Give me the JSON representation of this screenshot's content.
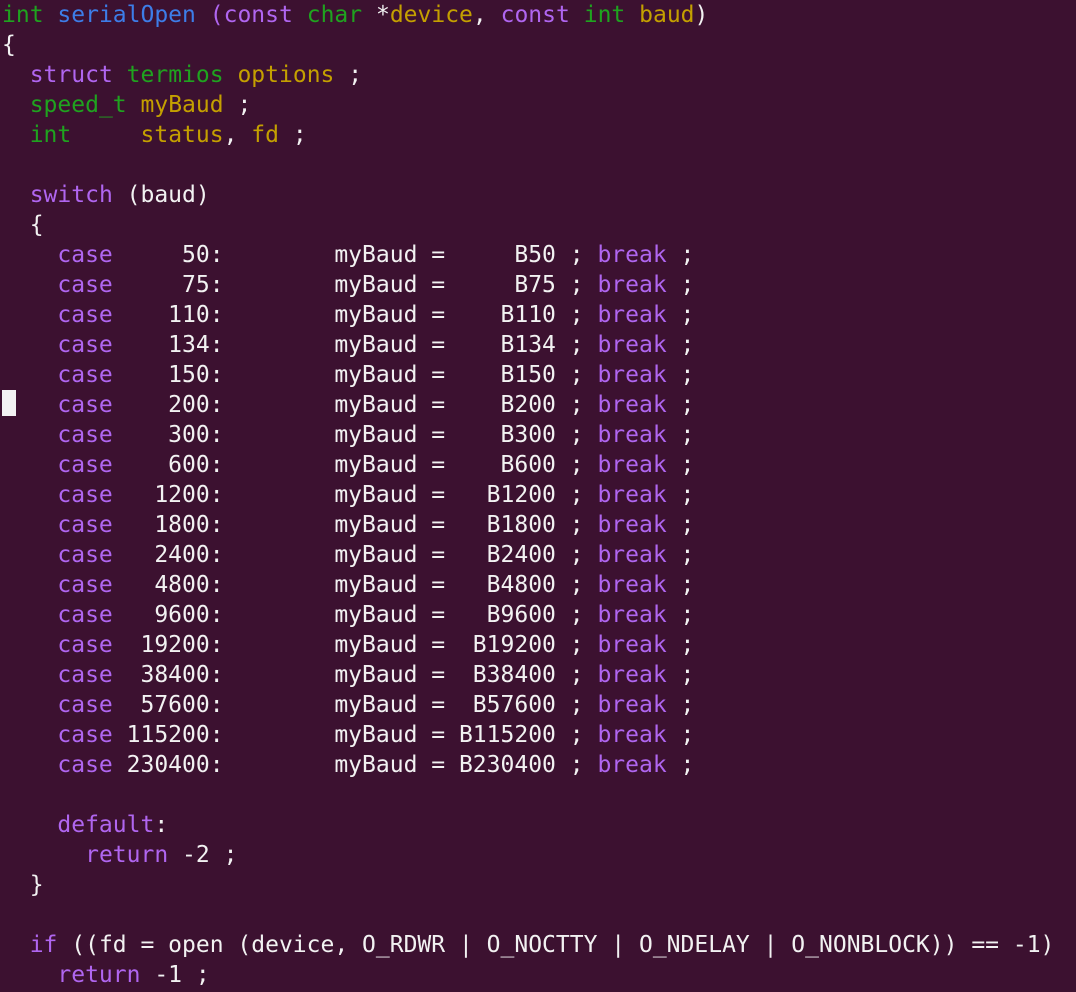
{
  "colors": {
    "background": "#3c1130",
    "plain": "#f2f2f2",
    "keyword": "#b066f0",
    "type": "#1fa31f",
    "identifier": "#c4a000",
    "function": "#3d7de8"
  },
  "lines": [
    [
      {
        "t": "int",
        "c": "type"
      },
      {
        "t": " ",
        "c": "plain"
      },
      {
        "t": "serialOpen",
        "c": "function"
      },
      {
        "t": " ",
        "c": "plain"
      },
      {
        "t": "(",
        "c": "keyword"
      },
      {
        "t": "const",
        "c": "keyword"
      },
      {
        "t": " ",
        "c": "plain"
      },
      {
        "t": "char",
        "c": "type"
      },
      {
        "t": " *",
        "c": "plain"
      },
      {
        "t": "device",
        "c": "identifier"
      },
      {
        "t": ", ",
        "c": "plain"
      },
      {
        "t": "const",
        "c": "keyword"
      },
      {
        "t": " ",
        "c": "plain"
      },
      {
        "t": "int",
        "c": "type"
      },
      {
        "t": " ",
        "c": "plain"
      },
      {
        "t": "baud",
        "c": "identifier"
      },
      {
        "t": ")",
        "c": "plain"
      }
    ],
    [
      {
        "t": "{",
        "c": "plain"
      }
    ],
    [
      {
        "t": "  ",
        "c": "plain"
      },
      {
        "t": "struct",
        "c": "keyword"
      },
      {
        "t": " ",
        "c": "plain"
      },
      {
        "t": "termios",
        "c": "type"
      },
      {
        "t": " ",
        "c": "plain"
      },
      {
        "t": "options",
        "c": "identifier"
      },
      {
        "t": " ;",
        "c": "plain"
      }
    ],
    [
      {
        "t": "  ",
        "c": "plain"
      },
      {
        "t": "speed_t",
        "c": "type"
      },
      {
        "t": " ",
        "c": "plain"
      },
      {
        "t": "myBaud",
        "c": "identifier"
      },
      {
        "t": " ;",
        "c": "plain"
      }
    ],
    [
      {
        "t": "  ",
        "c": "plain"
      },
      {
        "t": "int",
        "c": "type"
      },
      {
        "t": "     ",
        "c": "plain"
      },
      {
        "t": "status",
        "c": "identifier"
      },
      {
        "t": ", ",
        "c": "plain"
      },
      {
        "t": "fd",
        "c": "identifier"
      },
      {
        "t": " ;",
        "c": "plain"
      }
    ],
    [],
    [
      {
        "t": "  ",
        "c": "plain"
      },
      {
        "t": "switch",
        "c": "keyword"
      },
      {
        "t": " (baud)",
        "c": "plain"
      }
    ],
    [
      {
        "t": "  {",
        "c": "plain"
      }
    ],
    [
      {
        "t": "    ",
        "c": "plain"
      },
      {
        "t": "case",
        "c": "keyword"
      },
      {
        "t": "     50:        myBaud =     B50 ; ",
        "c": "plain"
      },
      {
        "t": "break",
        "c": "keyword"
      },
      {
        "t": " ;",
        "c": "plain"
      }
    ],
    [
      {
        "t": "    ",
        "c": "plain"
      },
      {
        "t": "case",
        "c": "keyword"
      },
      {
        "t": "     75:        myBaud =     B75 ; ",
        "c": "plain"
      },
      {
        "t": "break",
        "c": "keyword"
      },
      {
        "t": " ;",
        "c": "plain"
      }
    ],
    [
      {
        "t": "    ",
        "c": "plain"
      },
      {
        "t": "case",
        "c": "keyword"
      },
      {
        "t": "    110:        myBaud =    B110 ; ",
        "c": "plain"
      },
      {
        "t": "break",
        "c": "keyword"
      },
      {
        "t": " ;",
        "c": "plain"
      }
    ],
    [
      {
        "t": "    ",
        "c": "plain"
      },
      {
        "t": "case",
        "c": "keyword"
      },
      {
        "t": "    134:        myBaud =    B134 ; ",
        "c": "plain"
      },
      {
        "t": "break",
        "c": "keyword"
      },
      {
        "t": " ;",
        "c": "plain"
      }
    ],
    [
      {
        "t": "    ",
        "c": "plain"
      },
      {
        "t": "case",
        "c": "keyword"
      },
      {
        "t": "    150:        myBaud =    B150 ; ",
        "c": "plain"
      },
      {
        "t": "break",
        "c": "keyword"
      },
      {
        "t": " ;",
        "c": "plain"
      }
    ],
    [
      {
        "t": "    ",
        "c": "plain"
      },
      {
        "t": "case",
        "c": "keyword"
      },
      {
        "t": "    200:        myBaud =    B200 ; ",
        "c": "plain"
      },
      {
        "t": "break",
        "c": "keyword"
      },
      {
        "t": " ;",
        "c": "plain"
      }
    ],
    [
      {
        "t": "    ",
        "c": "plain"
      },
      {
        "t": "case",
        "c": "keyword"
      },
      {
        "t": "    300:        myBaud =    B300 ; ",
        "c": "plain"
      },
      {
        "t": "break",
        "c": "keyword"
      },
      {
        "t": " ;",
        "c": "plain"
      }
    ],
    [
      {
        "t": "    ",
        "c": "plain"
      },
      {
        "t": "case",
        "c": "keyword"
      },
      {
        "t": "    600:        myBaud =    B600 ; ",
        "c": "plain"
      },
      {
        "t": "break",
        "c": "keyword"
      },
      {
        "t": " ;",
        "c": "plain"
      }
    ],
    [
      {
        "t": "    ",
        "c": "plain"
      },
      {
        "t": "case",
        "c": "keyword"
      },
      {
        "t": "   1200:        myBaud =   B1200 ; ",
        "c": "plain"
      },
      {
        "t": "break",
        "c": "keyword"
      },
      {
        "t": " ;",
        "c": "plain"
      }
    ],
    [
      {
        "t": "    ",
        "c": "plain"
      },
      {
        "t": "case",
        "c": "keyword"
      },
      {
        "t": "   1800:        myBaud =   B1800 ; ",
        "c": "plain"
      },
      {
        "t": "break",
        "c": "keyword"
      },
      {
        "t": " ;",
        "c": "plain"
      }
    ],
    [
      {
        "t": "    ",
        "c": "plain"
      },
      {
        "t": "case",
        "c": "keyword"
      },
      {
        "t": "   2400:        myBaud =   B2400 ; ",
        "c": "plain"
      },
      {
        "t": "break",
        "c": "keyword"
      },
      {
        "t": " ;",
        "c": "plain"
      }
    ],
    [
      {
        "t": "    ",
        "c": "plain"
      },
      {
        "t": "case",
        "c": "keyword"
      },
      {
        "t": "   4800:        myBaud =   B4800 ; ",
        "c": "plain"
      },
      {
        "t": "break",
        "c": "keyword"
      },
      {
        "t": " ;",
        "c": "plain"
      }
    ],
    [
      {
        "t": "    ",
        "c": "plain"
      },
      {
        "t": "case",
        "c": "keyword"
      },
      {
        "t": "   9600:        myBaud =   B9600 ; ",
        "c": "plain"
      },
      {
        "t": "break",
        "c": "keyword"
      },
      {
        "t": " ;",
        "c": "plain"
      }
    ],
    [
      {
        "t": "    ",
        "c": "plain"
      },
      {
        "t": "case",
        "c": "keyword"
      },
      {
        "t": "  19200:        myBaud =  B19200 ; ",
        "c": "plain"
      },
      {
        "t": "break",
        "c": "keyword"
      },
      {
        "t": " ;",
        "c": "plain"
      }
    ],
    [
      {
        "t": "    ",
        "c": "plain"
      },
      {
        "t": "case",
        "c": "keyword"
      },
      {
        "t": "  38400:        myBaud =  B38400 ; ",
        "c": "plain"
      },
      {
        "t": "break",
        "c": "keyword"
      },
      {
        "t": " ;",
        "c": "plain"
      }
    ],
    [
      {
        "t": "    ",
        "c": "plain"
      },
      {
        "t": "case",
        "c": "keyword"
      },
      {
        "t": "  57600:        myBaud =  B57600 ; ",
        "c": "plain"
      },
      {
        "t": "break",
        "c": "keyword"
      },
      {
        "t": " ;",
        "c": "plain"
      }
    ],
    [
      {
        "t": "    ",
        "c": "plain"
      },
      {
        "t": "case",
        "c": "keyword"
      },
      {
        "t": " 115200:        myBaud = B115200 ; ",
        "c": "plain"
      },
      {
        "t": "break",
        "c": "keyword"
      },
      {
        "t": " ;",
        "c": "plain"
      }
    ],
    [
      {
        "t": "    ",
        "c": "plain"
      },
      {
        "t": "case",
        "c": "keyword"
      },
      {
        "t": " 230400:        myBaud = B230400 ; ",
        "c": "plain"
      },
      {
        "t": "break",
        "c": "keyword"
      },
      {
        "t": " ;",
        "c": "plain"
      }
    ],
    [],
    [
      {
        "t": "    ",
        "c": "plain"
      },
      {
        "t": "default",
        "c": "keyword"
      },
      {
        "t": ":",
        "c": "plain"
      }
    ],
    [
      {
        "t": "      ",
        "c": "plain"
      },
      {
        "t": "return",
        "c": "keyword"
      },
      {
        "t": " -2 ;",
        "c": "plain"
      }
    ],
    [
      {
        "t": "  }",
        "c": "plain"
      }
    ],
    [],
    [
      {
        "t": "  ",
        "c": "plain"
      },
      {
        "t": "if",
        "c": "keyword"
      },
      {
        "t": " ((fd = open (device, O_RDWR | O_NOCTTY | O_NDELAY | O_NONBLOCK)) == -1)",
        "c": "plain"
      }
    ],
    [
      {
        "t": "    ",
        "c": "plain"
      },
      {
        "t": "return",
        "c": "keyword"
      },
      {
        "t": " -1 ;",
        "c": "plain"
      }
    ]
  ]
}
